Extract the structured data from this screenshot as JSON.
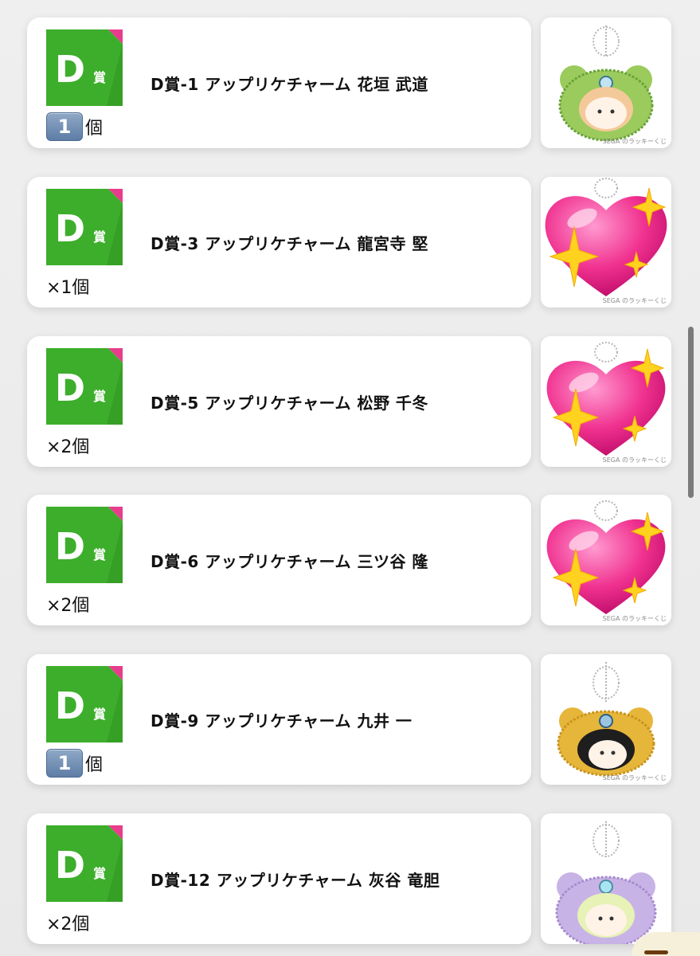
{
  "colors": {
    "badge_green": "#3dae2b",
    "badge_green_dark": "#2f8f1f",
    "badge_pink": "#e83d8c",
    "qty_box": "#6f8db3"
  },
  "items": [
    {
      "badge_letter": "D",
      "badge_kanji": "賞",
      "title": "D賞-1 アップリケチャーム 花垣 武道",
      "qty_boxed_number": "1",
      "qty_text": "個",
      "thumb_caption": "SEGA のラッキーくじ",
      "thumb_icon": "green-bear-charm-icon"
    },
    {
      "badge_letter": "D",
      "badge_kanji": "賞",
      "title": "D賞-3 アップリケチャーム 龍宮寺 堅",
      "qty_text": "×1個",
      "thumb_caption": "SEGA のラッキーくじ",
      "thumb_icon": "sparkling-heart-icon"
    },
    {
      "badge_letter": "D",
      "badge_kanji": "賞",
      "title": "D賞-5 アップリケチャーム 松野 千冬",
      "qty_text": "×2個",
      "thumb_caption": "SEGA のラッキーくじ",
      "thumb_icon": "sparkling-heart-icon"
    },
    {
      "badge_letter": "D",
      "badge_kanji": "賞",
      "title": "D賞-6 アップリケチャーム 三ツ谷 隆",
      "qty_text": "×2個",
      "thumb_caption": "SEGA のラッキーくじ",
      "thumb_icon": "sparkling-heart-icon"
    },
    {
      "badge_letter": "D",
      "badge_kanji": "賞",
      "title": "D賞-9 アップリケチャーム 九井 一",
      "qty_boxed_number": "1",
      "qty_text": "個",
      "thumb_caption": "SEGA のラッキーくじ",
      "thumb_icon": "yellow-bear-charm-icon"
    },
    {
      "badge_letter": "D",
      "badge_kanji": "賞",
      "title": "D賞-12 アップリケチャーム 灰谷 竜胆",
      "qty_text": "×2個",
      "thumb_caption": "",
      "thumb_icon": "purple-bear-charm-icon"
    }
  ]
}
